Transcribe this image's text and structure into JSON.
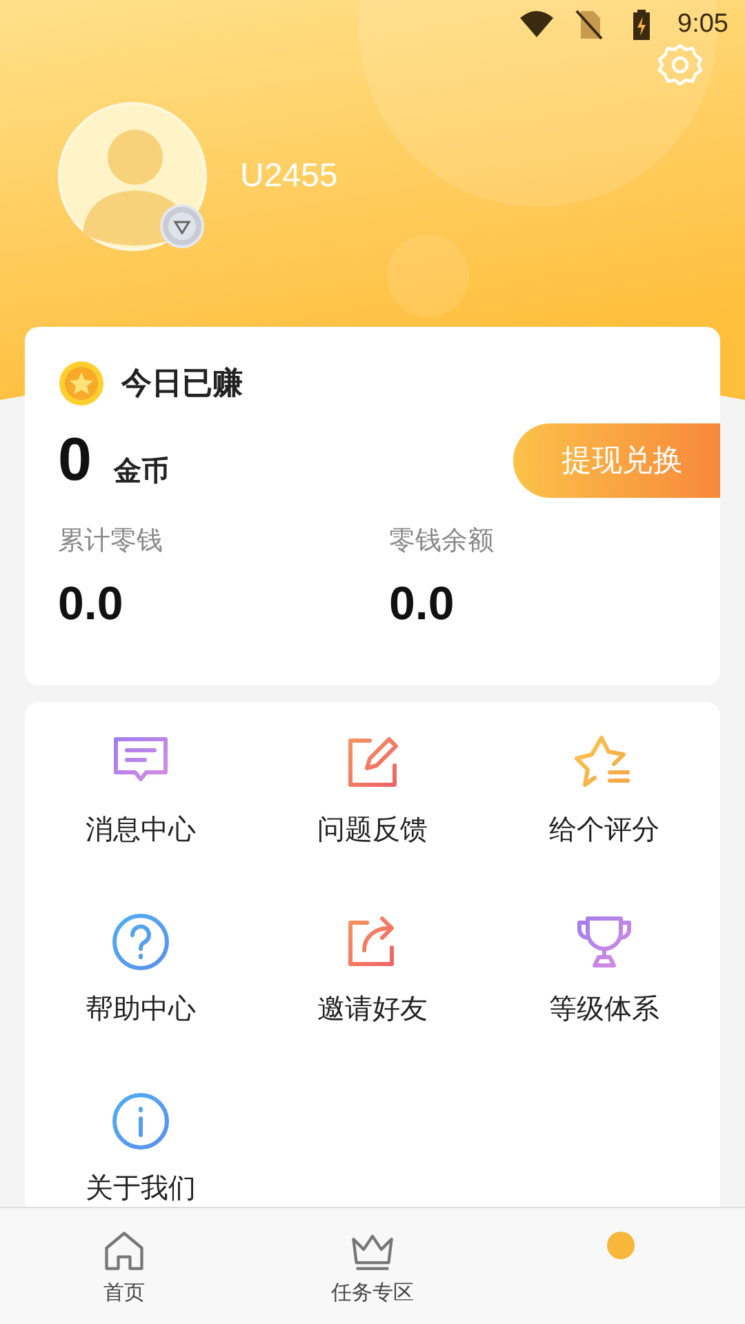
{
  "status_bar": {
    "time": "9:05"
  },
  "profile": {
    "username": "U2455"
  },
  "earnings": {
    "title": "今日已赚",
    "coins": "0",
    "coin_unit": "金币",
    "withdraw_button": "提现兑换",
    "stats": [
      {
        "label": "累计零钱",
        "value": "0.0"
      },
      {
        "label": "零钱余额",
        "value": "0.0"
      }
    ]
  },
  "menu": [
    {
      "kind": "message",
      "label": "消息中心"
    },
    {
      "kind": "feedback",
      "label": "问题反馈"
    },
    {
      "kind": "rate",
      "label": "给个评分"
    },
    {
      "kind": "help",
      "label": "帮助中心"
    },
    {
      "kind": "invite",
      "label": "邀请好友"
    },
    {
      "kind": "level",
      "label": "等级体系"
    },
    {
      "kind": "about",
      "label": "关于我们"
    }
  ],
  "tabs": [
    {
      "kind": "home",
      "label": "首页",
      "selected": false
    },
    {
      "kind": "tasks",
      "label": "任务专区",
      "selected": false
    },
    {
      "kind": "me",
      "selected": true
    }
  ]
}
